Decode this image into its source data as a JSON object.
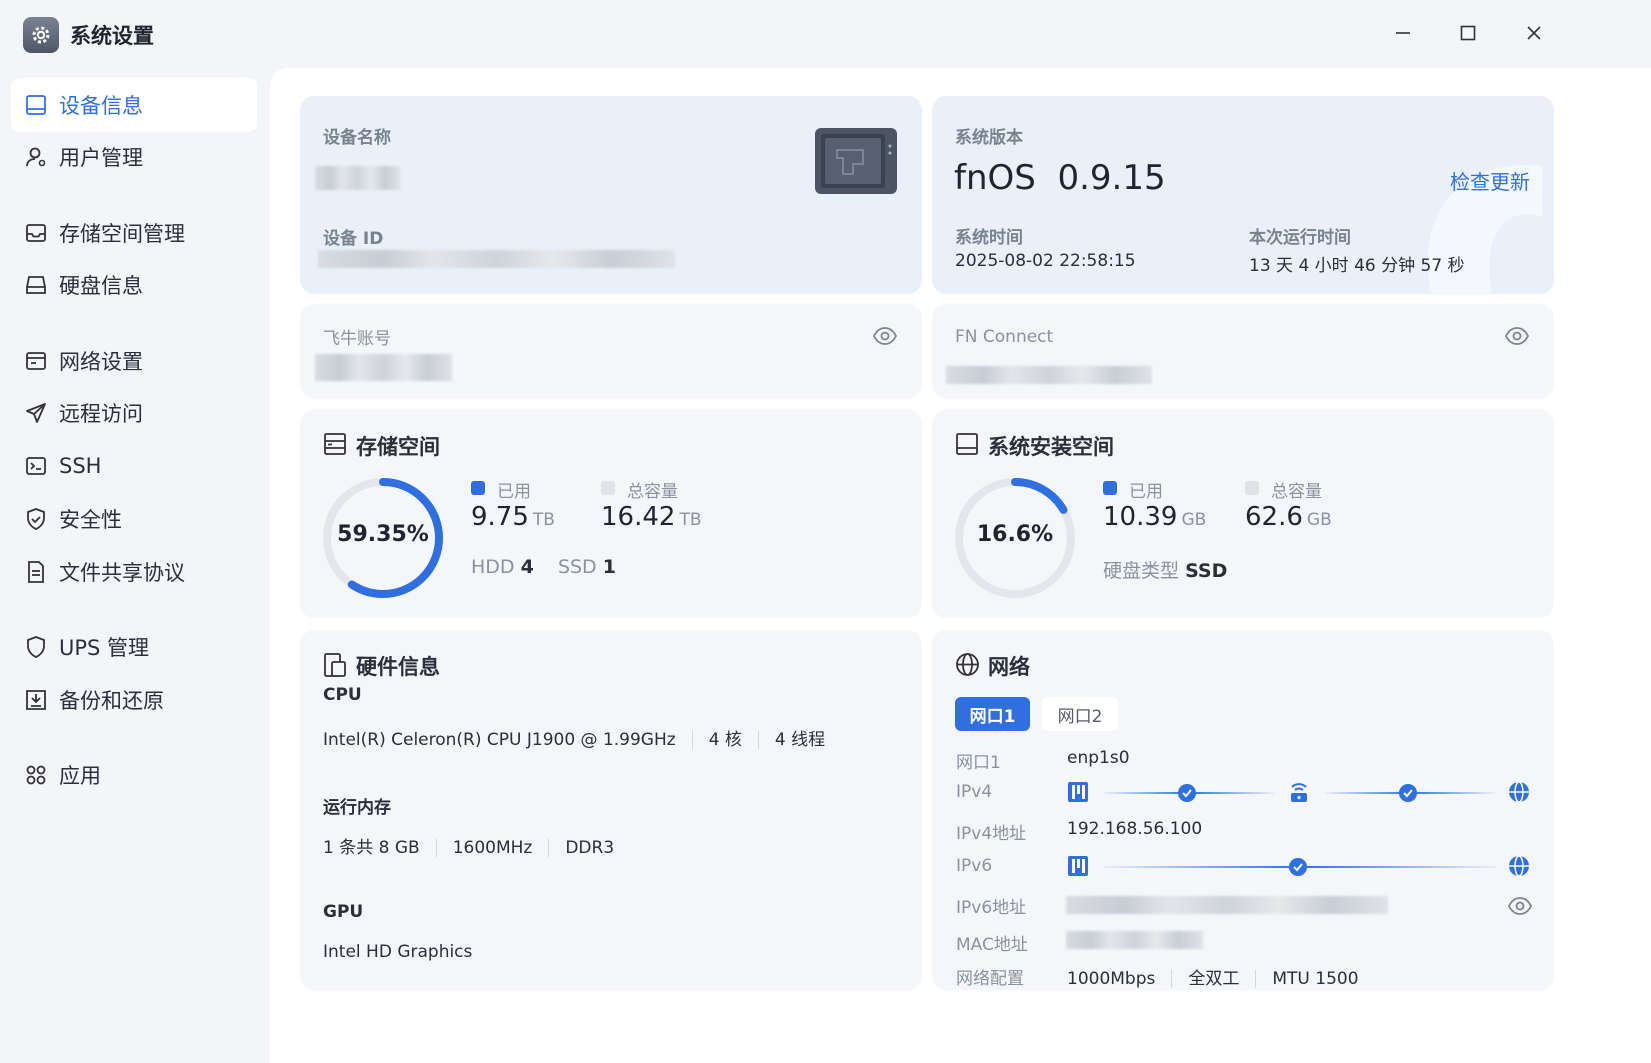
{
  "app": {
    "title": "系统设置"
  },
  "colors": {
    "accent": "#2f6fe0",
    "track": "#e3e6eb",
    "card": "#f4f6fa",
    "card_blue": "#e9f0fa"
  },
  "sidebar": {
    "items": [
      {
        "label": "设备信息",
        "icon": "device-icon",
        "active": true
      },
      {
        "label": "用户管理",
        "icon": "user-icon"
      },
      {
        "label": "存储空间管理",
        "icon": "storage-icon"
      },
      {
        "label": "硬盘信息",
        "icon": "disk-icon"
      },
      {
        "label": "网络设置",
        "icon": "network-icon"
      },
      {
        "label": "远程访问",
        "icon": "send-icon"
      },
      {
        "label": "SSH",
        "icon": "terminal-icon"
      },
      {
        "label": "安全性",
        "icon": "shield-check-icon"
      },
      {
        "label": "文件共享协议",
        "icon": "document-icon"
      },
      {
        "label": "UPS 管理",
        "icon": "shield-icon"
      },
      {
        "label": "备份和还原",
        "icon": "backup-icon"
      },
      {
        "label": "应用",
        "icon": "apps-icon"
      }
    ]
  },
  "device": {
    "name_label": "设备名称",
    "id_label": "设备 ID"
  },
  "system": {
    "version_label": "系统版本",
    "version": "fnOS  0.9.15",
    "check_update": "检查更新",
    "time_label": "系统时间",
    "time": "2025-08-02 22:58:15",
    "uptime_label": "本次运行时间",
    "uptime": "13 天 4 小时 46 分钟 57 秒"
  },
  "accounts": {
    "feiniu_label": "飞牛账号",
    "fnconnect_label": "FN Connect"
  },
  "storage": {
    "title": "存储空间",
    "percent_text": "59.35%",
    "percent": 59.35,
    "used_label": "已用",
    "used_value": "9.75",
    "used_unit": "TB",
    "total_label": "总容量",
    "total_value": "16.42",
    "total_unit": "TB",
    "hdd_label": "HDD",
    "hdd_count": "4",
    "ssd_label": "SSD",
    "ssd_count": "1"
  },
  "sysdisk": {
    "title": "系统安装空间",
    "percent_text": "16.6%",
    "percent": 16.6,
    "used_label": "已用",
    "used_value": "10.39",
    "used_unit": "GB",
    "total_label": "总容量",
    "total_value": "62.6",
    "total_unit": "GB",
    "type_label": "硬盘类型",
    "type_value": "SSD"
  },
  "hardware": {
    "title": "硬件信息",
    "cpu_label": "CPU",
    "cpu_model": "Intel(R) Celeron(R) CPU J1900 @ 1.99GHz",
    "cpu_cores": "4 核",
    "cpu_threads": "4 线程",
    "mem_label": "运行内存",
    "mem_size": "1 条共 8 GB",
    "mem_freq": "1600MHz",
    "mem_type": "DDR3",
    "gpu_label": "GPU",
    "gpu_model": "Intel HD Graphics"
  },
  "network": {
    "title": "网络",
    "tabs": [
      {
        "label": "网口1",
        "active": true
      },
      {
        "label": "网口2"
      }
    ],
    "port_label": "网口1",
    "port_value": "enp1s0",
    "ipv4_label": "IPv4",
    "ipv4_addr_label": "IPv4地址",
    "ipv4_addr": "192.168.56.100",
    "ipv6_label": "IPv6",
    "ipv6_addr_label": "IPv6地址",
    "mac_label": "MAC地址",
    "config_label": "网络配置",
    "speed": "1000Mbps",
    "duplex": "全双工",
    "mtu": "MTU 1500"
  }
}
